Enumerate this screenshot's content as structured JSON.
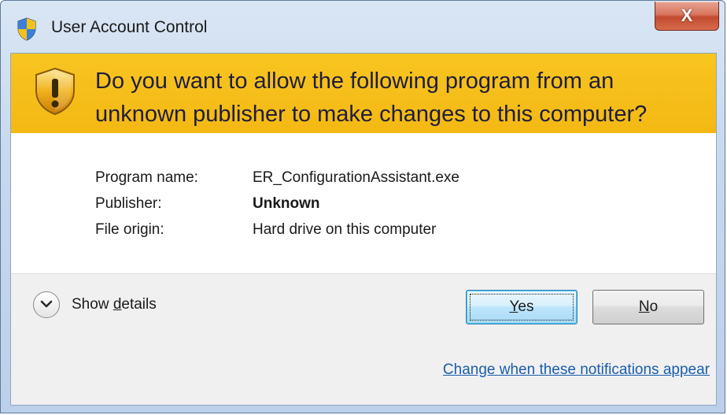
{
  "window": {
    "title": "User Account Control",
    "close_label": "X"
  },
  "banner": {
    "line1": "Do you want to allow the following program from an",
    "line2": "unknown publisher to make changes to this computer?"
  },
  "info": {
    "rows": [
      {
        "label": "Program name:",
        "value": "ER_ConfigurationAssistant.exe"
      },
      {
        "label": "Publisher:",
        "value": "Unknown"
      },
      {
        "label": "File origin:",
        "value": "Hard drive on this computer"
      }
    ]
  },
  "details": {
    "prefix": "Show ",
    "accel": "d",
    "suffix": "etails"
  },
  "buttons": {
    "yes": {
      "accel": "Y",
      "rest": "es"
    },
    "no": {
      "accel": "N",
      "rest": "o"
    }
  },
  "link": {
    "label": "Change when these notifications appear"
  },
  "colors": {
    "banner": "#f6c01a",
    "link": "#1a5dab",
    "close_button": "#c34a2f"
  },
  "icons": {
    "title": "uac-shield-icon",
    "banner": "warning-shield-icon",
    "details": "chevron-down-icon"
  }
}
